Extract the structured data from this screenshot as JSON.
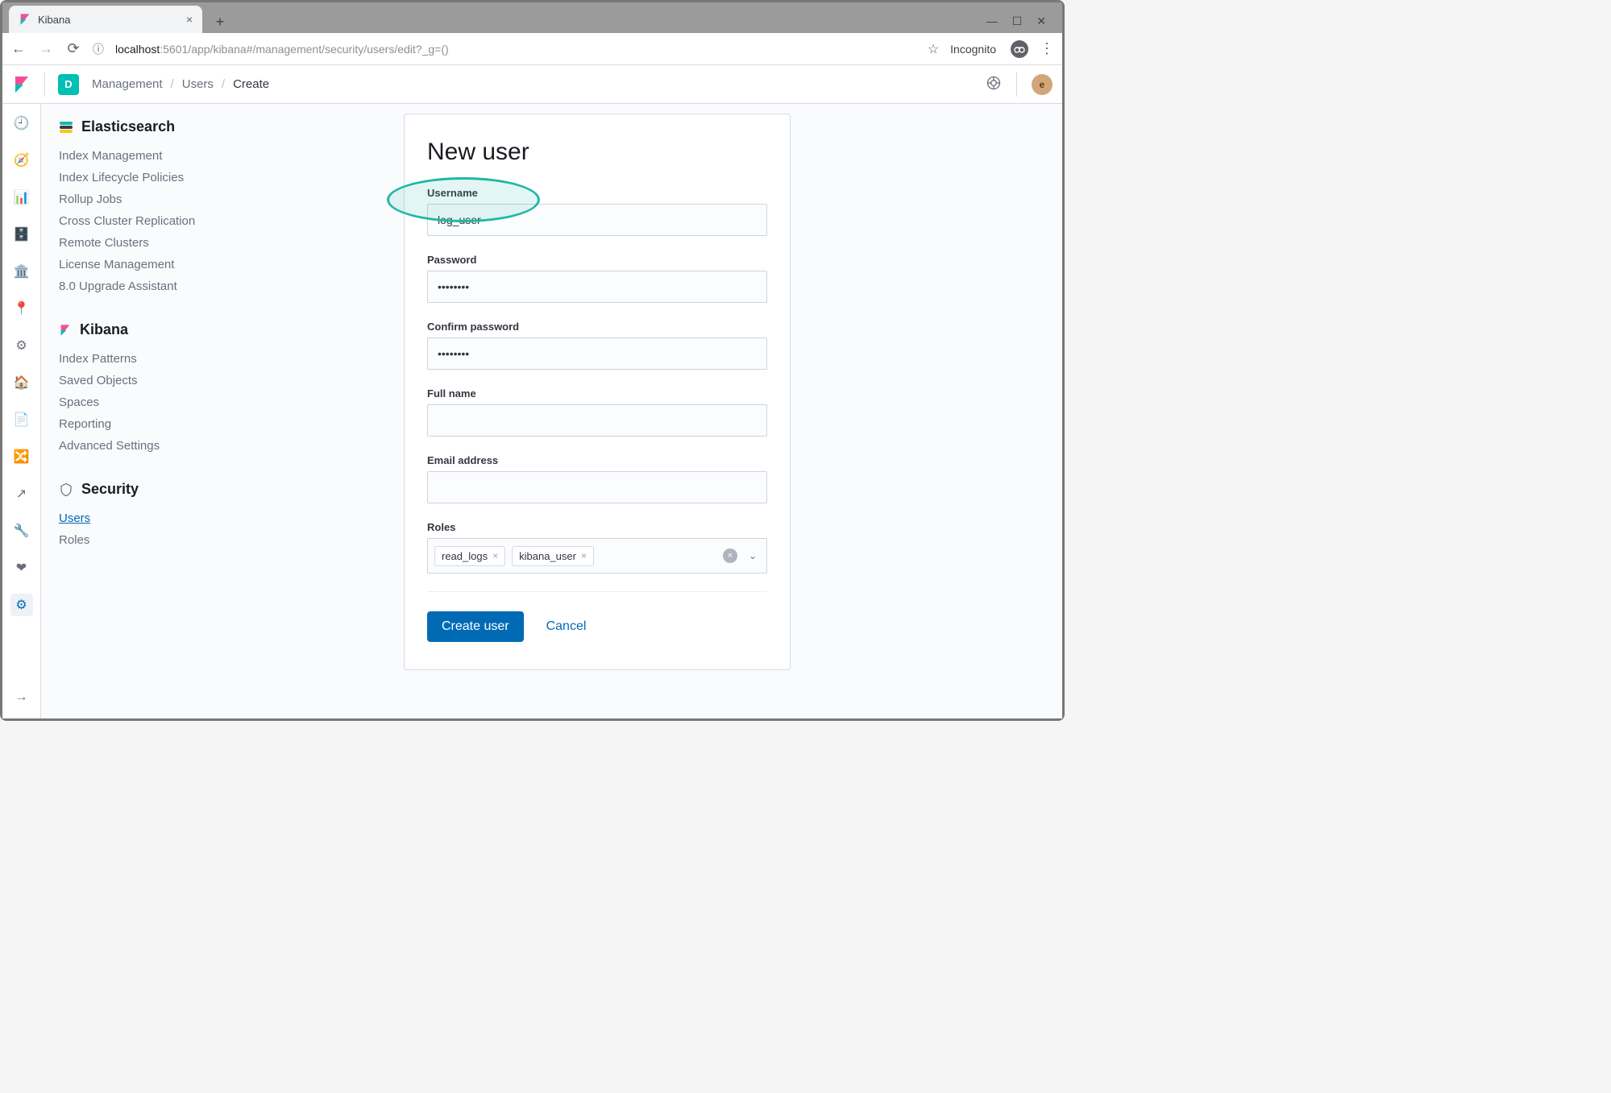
{
  "browser": {
    "tab_title": "Kibana",
    "new_tab_label": "+",
    "url_host": "localhost",
    "url_rest": ":5601/app/kibana#/management/security/users/edit?_g=()",
    "incognito_label": "Incognito"
  },
  "header": {
    "space_letter": "D",
    "breadcrumbs": [
      "Management",
      "Users",
      "Create"
    ],
    "avatar_letter": "e"
  },
  "sidebar": {
    "es": {
      "title": "Elasticsearch",
      "items": [
        "Index Management",
        "Index Lifecycle Policies",
        "Rollup Jobs",
        "Cross Cluster Replication",
        "Remote Clusters",
        "License Management",
        "8.0 Upgrade Assistant"
      ]
    },
    "kibana": {
      "title": "Kibana",
      "items": [
        "Index Patterns",
        "Saved Objects",
        "Spaces",
        "Reporting",
        "Advanced Settings"
      ]
    },
    "security": {
      "title": "Security",
      "items": [
        "Users",
        "Roles"
      ],
      "active": "Users"
    }
  },
  "form": {
    "title": "New user",
    "labels": {
      "username": "Username",
      "password": "Password",
      "confirm": "Confirm password",
      "fullname": "Full name",
      "email": "Email address",
      "roles": "Roles"
    },
    "values": {
      "username": "log_user",
      "password": "••••••••",
      "confirm": "••••••••",
      "fullname": "",
      "email": ""
    },
    "roles": [
      "read_logs",
      "kibana_user"
    ],
    "actions": {
      "create": "Create user",
      "cancel": "Cancel"
    }
  }
}
